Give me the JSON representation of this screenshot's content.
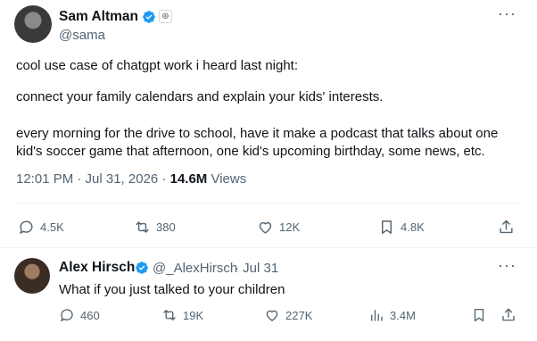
{
  "main_tweet": {
    "author_name": "Sam Altman",
    "author_handle": "@sama",
    "paragraphs": [
      "cool use case of chatgpt work i heard last night:",
      "connect your family calendars and explain your kids' interests.",
      "every morning for the drive to school, have it make a podcast that talks about one kid's soccer game that afternoon, one kid's upcoming birthday, some news, etc."
    ],
    "timestamp": "12:01 PM · Jul 31, 2026 · ",
    "views_count": "14.6M",
    "views_label": " Views",
    "actions": {
      "replies": "4.5K",
      "retweets": "380",
      "likes": "12K",
      "bookmarks": "4.8K"
    }
  },
  "reply_tweet": {
    "author_name": "Alex Hirsch",
    "author_handle": "@_AlexHirsch",
    "date": " · Jul 31",
    "text": "What if you just talked to your children",
    "actions": {
      "replies": "460",
      "retweets": "19K",
      "likes": "227K",
      "views": "3.4M"
    }
  },
  "colors": {
    "verified_blue": "#1d9bf0",
    "text_primary": "#0f1419",
    "text_secondary": "#536471",
    "divider": "#eff3f4"
  },
  "icons": [
    "verified-badge-icon",
    "affiliate-badge-icon",
    "more-icon",
    "reply-icon",
    "retweet-icon",
    "like-icon",
    "bookmark-icon",
    "share-icon",
    "views-icon"
  ]
}
